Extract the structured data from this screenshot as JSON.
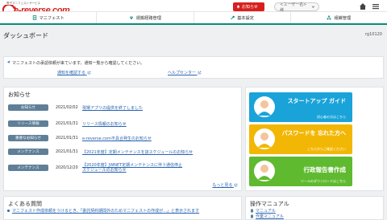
{
  "header": {
    "logo_tagline": "電子マニフェストサービス",
    "logo_text": "e-reverse.com",
    "notify_label": "お知らせ",
    "user_label": "<ユーザー名>様",
    "colors": {
      "brand_red": "#d7201e",
      "accent_green": "#0b8a7a"
    }
  },
  "nav": {
    "items": [
      {
        "label": "マニフェスト",
        "icon": "document-icon"
      },
      {
        "label": "運搬経路管理",
        "icon": "map-pin-icon"
      },
      {
        "label": "基本設定",
        "icon": "wrench-icon"
      },
      {
        "label": "組織管理",
        "icon": "org-chart-icon"
      }
    ]
  },
  "page": {
    "title": "ダッシュボード",
    "user_id": "rg10120"
  },
  "notice": {
    "text": "マニフェストの承認依頼が来ています。通知一覧から確認してください。",
    "link1": "通知を確認する",
    "link2": "ヘルプセンター"
  },
  "news": {
    "title": "お知らせ",
    "items": [
      {
        "badge": "お知らせ",
        "date": "2021/02/02",
        "text": "現場アプリの提供を終了しました"
      },
      {
        "badge": "リリース情報",
        "date": "2021/01/31",
        "text": "リリース情報のお知らせ"
      },
      {
        "badge": "重要なお知らせ",
        "date": "2021/01/31",
        "text": "e-reverse.com不具合発生のお知らせ"
      },
      {
        "badge": "メンテナンス",
        "date": "2021/01/31",
        "text": "【2021年度】定期メンテナンスを該スケジュールのお知らせ"
      },
      {
        "badge": "メンテナンス",
        "date": "2020/12/20",
        "text": "【2020年度】JWNET定期メンテナンスに伴う通信停止スケジュールのお知らせ"
      }
    ],
    "more_label": "もっと見る"
  },
  "banners": [
    {
      "title": "スタートアップ ガイド",
      "sub": "初心者の方はこちら",
      "color": "#1aa3d9"
    },
    {
      "title": "パスワードを 忘れた方へ",
      "sub": "こちらからご確認ください",
      "color": "#f2b705"
    },
    {
      "title": "行政報告書作成",
      "sub": "ツールのダウンロードはこちら",
      "color": "#5fba2f"
    }
  ],
  "faq": {
    "title": "よくある質問",
    "item": "マニフェスト作成依頼をうけるとき、「委託契約期間外のためマニフェストの作成が…」と表示されます"
  },
  "manual": {
    "title": "操作マニュアル",
    "items": [
      "マニュアル",
      "作業マニュアル"
    ]
  }
}
